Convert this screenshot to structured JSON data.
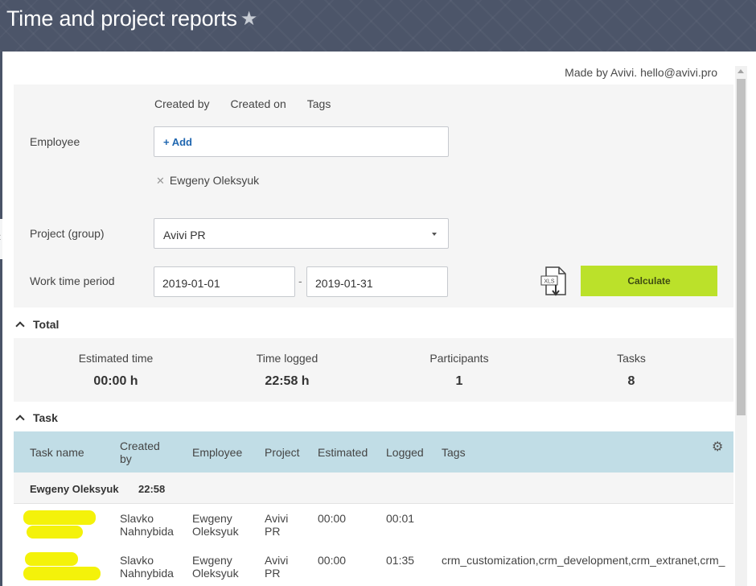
{
  "header": {
    "title": "Time and project reports",
    "star_icon": "star-icon"
  },
  "made_by": "Made by Avivi. hello@avivi.pro",
  "filters": {
    "tabs": [
      "Created by",
      "Created on",
      "Tags"
    ],
    "employee_label": "Employee",
    "add_label": "+ Add",
    "selected_employee": "Ewgeny Oleksyuk",
    "project_label": "Project (group)",
    "project_value": "Avivi PR",
    "period_label": "Work time period",
    "date_from": "2019-01-01",
    "date_to": "2019-01-31",
    "date_separator": "-",
    "export_icon": "xls-export-icon",
    "calculate_label": "Calculate"
  },
  "total": {
    "heading": "Total",
    "stats": [
      {
        "label": "Estimated time",
        "value": "00:00 h"
      },
      {
        "label": "Time logged",
        "value": "22:58 h"
      },
      {
        "label": "Participants",
        "value": "1"
      },
      {
        "label": "Tasks",
        "value": "8"
      }
    ]
  },
  "task": {
    "heading": "Task",
    "columns": [
      "Task name",
      "Created by",
      "Employee",
      "Project",
      "Estimated",
      "Logged",
      "Tags"
    ],
    "group": {
      "name": "Ewgeny Oleksyuk",
      "total": "22:58"
    },
    "rows": [
      {
        "created_by": "Slavko Nahnybida",
        "employee": "Ewgeny Oleksyuk",
        "project": "Avivi PR",
        "estimated": "00:00",
        "logged": "00:01",
        "tags": ""
      },
      {
        "created_by": "Slavko Nahnybida",
        "employee": "Ewgeny Oleksyuk",
        "project": "Avivi PR",
        "estimated": "00:00",
        "logged": "01:35",
        "tags": "crm_customization,crm_development,crm_extranet,crm_"
      }
    ]
  },
  "colors": {
    "accent_button": "#bbe12a",
    "table_header": "#c1dde6",
    "redaction": "#f4f20a"
  }
}
